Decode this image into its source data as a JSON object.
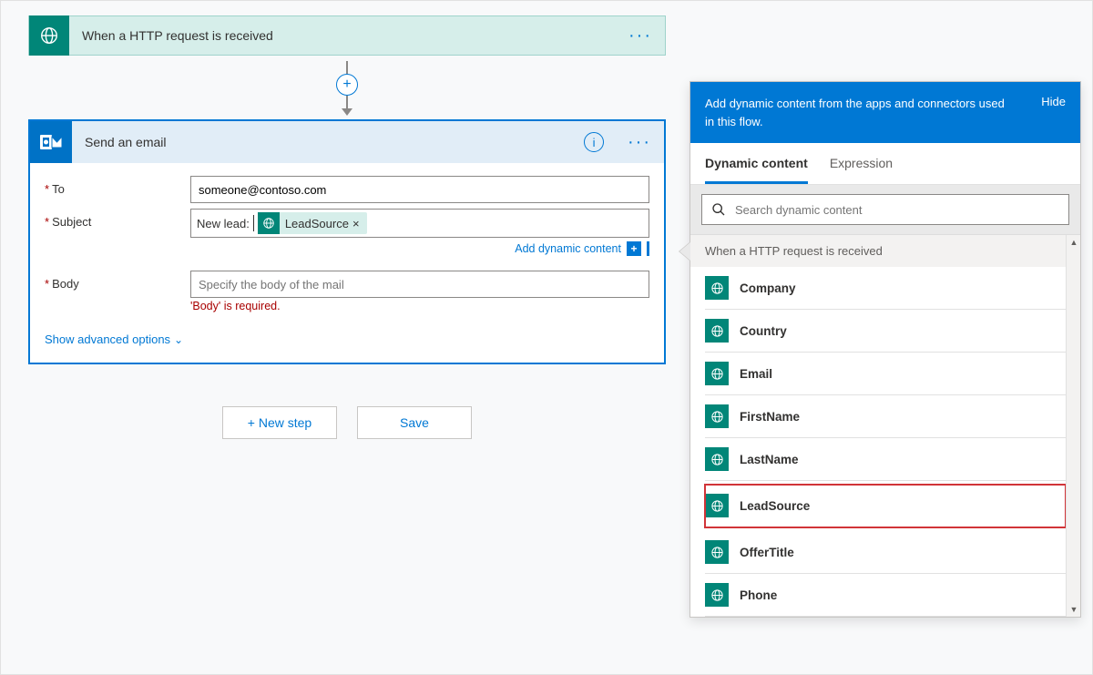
{
  "trigger": {
    "title": "When a HTTP request is received"
  },
  "email_action": {
    "title": "Send an email",
    "fields": {
      "to_label": "To",
      "to_value": "someone@contoso.com",
      "subject_label": "Subject",
      "subject_prefix": "New lead:",
      "subject_token": "LeadSource",
      "body_label": "Body",
      "body_placeholder": "Specify the body of the mail",
      "body_error": "'Body' is required."
    },
    "add_dynamic_link": "Add dynamic content",
    "show_advanced": "Show advanced options"
  },
  "buttons": {
    "new_step": "+ New step",
    "save": "Save"
  },
  "dynamic_panel": {
    "header_text": "Add dynamic content from the apps and connectors used in this flow.",
    "hide": "Hide",
    "tabs": {
      "dynamic": "Dynamic content",
      "expression": "Expression"
    },
    "search_placeholder": "Search dynamic content",
    "group_header": "When a HTTP request is received",
    "items": [
      "Company",
      "Country",
      "Email",
      "FirstName",
      "LastName",
      "LeadSource",
      "OfferTitle",
      "Phone"
    ],
    "highlighted": "LeadSource"
  }
}
